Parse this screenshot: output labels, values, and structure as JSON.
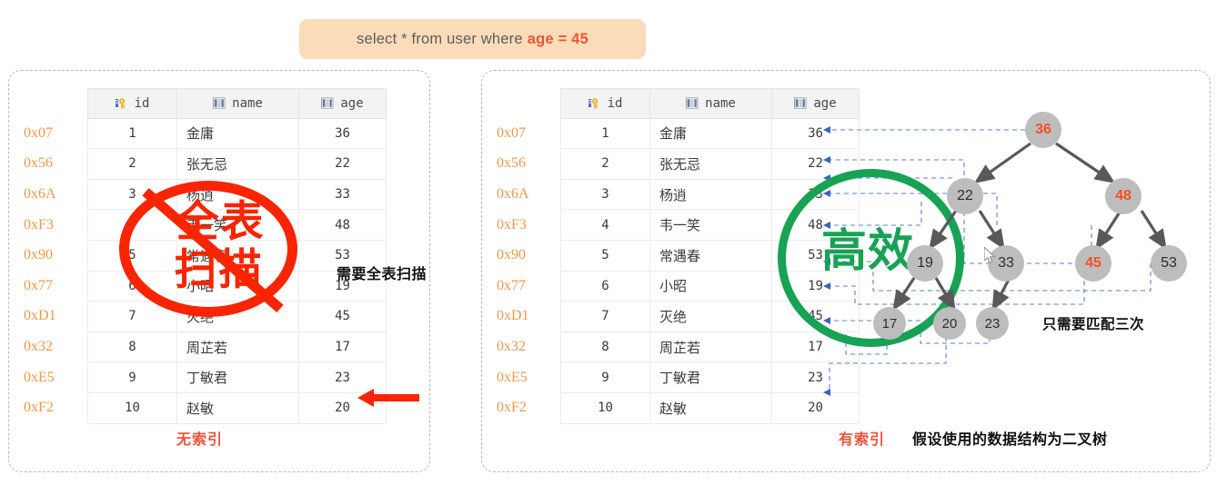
{
  "query": {
    "prefix": "select * from user where",
    "accent": "age = 45",
    "full": "select * from user where age = 45"
  },
  "columns": {
    "addr_header": "",
    "id": "id",
    "name": "name",
    "age": "age",
    "id_icon": "primary-key-icon",
    "name_icon": "column-icon",
    "age_icon": "column-icon"
  },
  "rows": [
    {
      "addr": "0x07",
      "id": "1",
      "name": "金庸",
      "age": "36"
    },
    {
      "addr": "0x56",
      "id": "2",
      "name": "张无忌",
      "age": "22"
    },
    {
      "addr": "0x6A",
      "id": "3",
      "name": "杨逍",
      "age": "33"
    },
    {
      "addr": "0xF3",
      "id": "4",
      "name": "韦一笑",
      "age": "48"
    },
    {
      "addr": "0x90",
      "id": "5",
      "name": "常遇春",
      "age": "53"
    },
    {
      "addr": "0x77",
      "id": "6",
      "name": "小昭",
      "age": "19"
    },
    {
      "addr": "0xD1",
      "id": "7",
      "name": "灭绝",
      "age": "45"
    },
    {
      "addr": "0x32",
      "id": "8",
      "name": "周芷若",
      "age": "17"
    },
    {
      "addr": "0xE5",
      "id": "9",
      "name": "丁敏君",
      "age": "23"
    },
    {
      "addr": "0xF2",
      "id": "10",
      "name": "赵敏",
      "age": "20"
    }
  ],
  "left_panel": {
    "stamp_line1": "全表",
    "stamp_line2": "扫描",
    "stamp_color": "#fa2400",
    "caption": "无索引",
    "note": "需要全表扫描"
  },
  "right_panel": {
    "stamp_text": "高效",
    "stamp_color": "#17a254",
    "caption": "有索引",
    "assume_note": "假设使用的数据结构为二叉树",
    "match_note": "只需要匹配三次"
  },
  "tree": {
    "nodes": [
      {
        "key": "root",
        "value": "36",
        "highlight": true
      },
      {
        "key": "n22",
        "value": "22",
        "highlight": false
      },
      {
        "key": "n48",
        "value": "48",
        "highlight": true
      },
      {
        "key": "n19",
        "value": "19",
        "highlight": false
      },
      {
        "key": "n33",
        "value": "33",
        "highlight": false
      },
      {
        "key": "n45",
        "value": "45",
        "highlight": true
      },
      {
        "key": "n53",
        "value": "53",
        "highlight": false
      },
      {
        "key": "n17",
        "value": "17",
        "highlight": false
      },
      {
        "key": "n20",
        "value": "20",
        "highlight": false
      },
      {
        "key": "n23",
        "value": "23",
        "highlight": false
      }
    ],
    "search_path": [
      "36",
      "48",
      "45"
    ],
    "node_fill": "#bdbdbd",
    "highlight_color": "#f4511e"
  },
  "colors": {
    "sql_bg": "#fbdcb9",
    "sql_text": "#5d5d5d",
    "sql_accent": "#f0533a",
    "address": "#f0974a",
    "dashed_arrow": "#4a6fc4",
    "panel_border": "#b9b9b9",
    "red_arrow": "#fa2400"
  }
}
